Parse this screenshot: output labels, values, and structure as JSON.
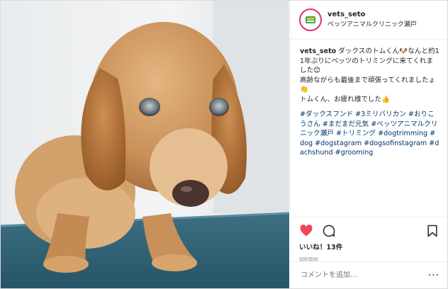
{
  "post": {
    "photo_alt": "ダックスフンドのトムくん",
    "username": "vets_seto",
    "location": "ベッツアニマルクリニック瀬戸",
    "caption_user": "vets_seto",
    "caption_text": " ダックスのトムくん🐶なんと約11年ぶりにベッツのトリミングに来てくれました😊\n高齢ながらも最後まで頑張ってくれましたょ👏\nトムくん、お疲れ様でした👍",
    "hashtags": "#ダックスフンド #3ミリバリカン #おりこうさん #まだまだ元気 #ベッツアニマルクリニック瀬戸 #トリミング #dogtrimming #dog #dogstagram #dogsofinstagram #dachshund #grooming",
    "likes": "いいね！13件",
    "time": "8時間前",
    "comment_placeholder": "コメントを追加...",
    "more": "···"
  },
  "colors": {
    "accent": "#e1306c",
    "like": "#ed4956",
    "hashtag": "#003569",
    "muted": "#999999",
    "border": "#efefef"
  },
  "icons": {
    "like": "heart-icon",
    "comment": "comment-icon",
    "save": "bookmark-icon",
    "more": "more-icon"
  }
}
